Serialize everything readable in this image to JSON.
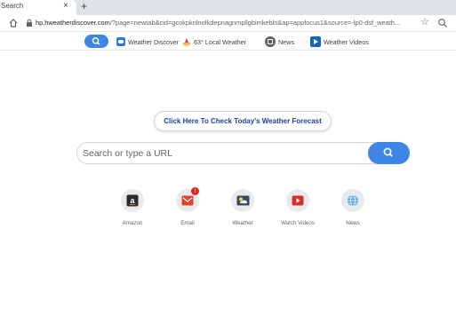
{
  "browser": {
    "tab_title": "Search",
    "tab_close": "×",
    "new_tab": "+",
    "url_host": "hp.hweatherdiscover.com",
    "url_rest": "/?page=newtab&cid=gcokpknlnofkdepnagnmpllgbimkebln&ap=appfocus1&source=-lp0-dsf_weath...",
    "star": "☆"
  },
  "extension_bar": {
    "items": [
      {
        "label": "Weather Discover",
        "icon": "weather-discover-icon"
      },
      {
        "label": "63° Local Weather",
        "icon": "local-weather-icon"
      },
      {
        "label": "News",
        "icon": "news-icon"
      },
      {
        "label": "Weather Videos",
        "icon": "weather-videos-icon"
      }
    ]
  },
  "main": {
    "cta_label": "Click Here To Check Today's Weather Forecast",
    "search_placeholder": "Search or type a URL",
    "tiles": [
      {
        "label": "Amazon",
        "icon": "amazon-icon"
      },
      {
        "label": "Email",
        "icon": "email-icon",
        "badge": "!"
      },
      {
        "label": "Weather",
        "icon": "weather-icon"
      },
      {
        "label": "Watch Videos",
        "icon": "watch-videos-icon"
      },
      {
        "label": "News",
        "icon": "news-globe-icon"
      }
    ]
  },
  "colors": {
    "accent": "#3d86e6",
    "cta_text": "#1a3fa8",
    "badge": "#e2231a",
    "tab_strip": "#dee1e6"
  }
}
